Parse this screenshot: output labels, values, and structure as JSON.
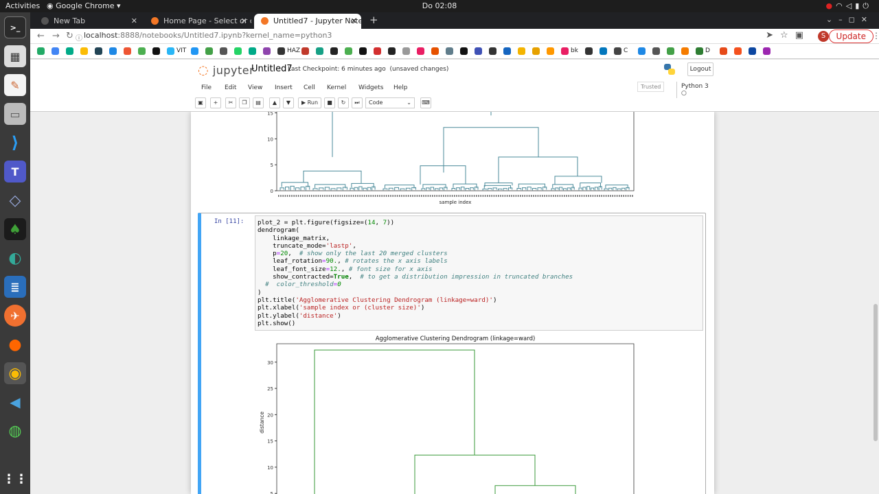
{
  "os": {
    "activities": "Activities",
    "app_name": "Google Chrome",
    "clock": "Do 02:08"
  },
  "browser": {
    "tabs": [
      {
        "label": "New Tab"
      },
      {
        "label": "Home Page - Select or cre"
      },
      {
        "label": "Untitled7 - Jupyter Noteb"
      }
    ],
    "url_host": "localhost",
    "url_rest": ":8888/notebooks/Untitled7.ipynb?kernel_name=python3",
    "update_label": "Update",
    "avatar_letter": "S",
    "bookmark_labels": [
      "VIT",
      "HAZ",
      "bk",
      "C",
      "D"
    ]
  },
  "jupyter": {
    "logo_text": "jupyter",
    "notebook_name": "Untitled7",
    "checkpoint": "Last Checkpoint: 6 minutes ago",
    "unsaved": "(unsaved changes)",
    "logout": "Logout",
    "menu": [
      "File",
      "Edit",
      "View",
      "Insert",
      "Cell",
      "Kernel",
      "Widgets",
      "Help"
    ],
    "trusted": "Trusted",
    "kernel": "Python 3",
    "run_label": "Run",
    "cell_type": "Code",
    "cell_prompt": "In [11]:",
    "code_lines": [
      "plot_2 = plt.figure(figsize=(14, 7))",
      "dendrogram(",
      "    linkage_matrix,",
      "    truncate_mode='lastp',",
      "    p=20,  # show only the last 20 merged clusters",
      "    leaf_rotation=90., # rotates the x axis labels",
      "    leaf_font_size=12., # font size for x axis",
      "    show_contracted=True,  # to get a distribution impression in truncated branches",
      "  #  color_threshold=0",
      ")",
      "plt.title('Agglomerative Clustering Dendrogram (linkage=ward)')",
      "plt.xlabel('sample index or (cluster size)')",
      "plt.ylabel('distance')",
      "plt.show()"
    ]
  },
  "chart_data": [
    {
      "type": "dendrogram",
      "title": "",
      "xlabel": "sample index",
      "ylabel": "",
      "yticks": [
        0,
        5,
        10,
        15
      ],
      "visible_ylim": [
        0,
        15
      ],
      "merge_heights": [
        14.5,
        12.2,
        6.5,
        4.8,
        3.8
      ],
      "color": "#4a8a9a"
    },
    {
      "type": "dendrogram",
      "title": "Agglomerative Clustering Dendrogram (linkage=ward)",
      "xlabel": "",
      "ylabel": "distance",
      "yticks": [
        5,
        10,
        15,
        20,
        25,
        30
      ],
      "visible_ylim": [
        4.8,
        33.5
      ],
      "merge_heights": [
        32.3,
        12.3,
        6.5,
        4.8
      ],
      "color": "#3a9a3a"
    }
  ]
}
